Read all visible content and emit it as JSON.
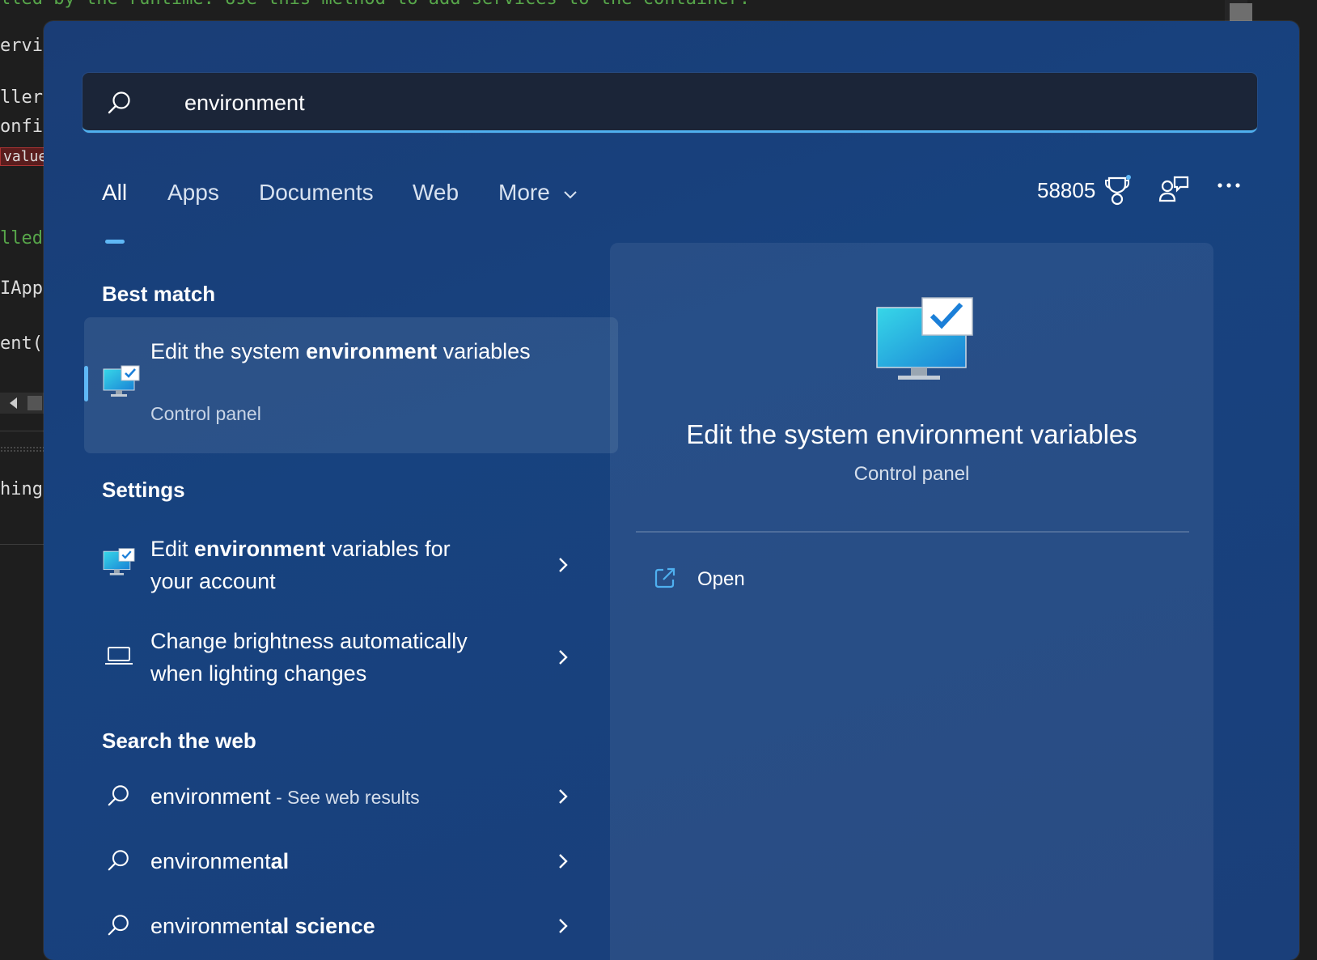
{
  "editor": {
    "lines": [
      {
        "text": "lled by the runtime. Use this method to add services to the container.",
        "style": "green"
      },
      {
        "text": "ervic",
        "style": "plain"
      },
      {
        "text": "llers",
        "style": "plain"
      },
      {
        "text": "onfig",
        "style": "plain"
      },
      {
        "text": "value",
        "style": "badge"
      },
      {
        "text": "lled",
        "style": "green"
      },
      {
        "text": "IApp",
        "style": "plain"
      },
      {
        "text": "ent(",
        "style": "plain"
      },
      {
        "text": "hings",
        "style": "plain"
      }
    ]
  },
  "search": {
    "value": "environment",
    "icon": "search-icon"
  },
  "tabs": [
    {
      "label": "All",
      "active": true
    },
    {
      "label": "Apps",
      "active": false
    },
    {
      "label": "Documents",
      "active": false
    },
    {
      "label": "Web",
      "active": false
    },
    {
      "label": "More",
      "active": false
    }
  ],
  "toolbar": {
    "points": "58805",
    "icons": [
      "rewards-trophy-icon",
      "people-chat-icon",
      "more-options-icon"
    ],
    "accent": "#5fb8f6"
  },
  "best_match": {
    "heading": "Best match",
    "title_pre": "Edit the system ",
    "title_bold": "environment",
    "title_post": " variables",
    "subtitle": "Control panel"
  },
  "settings": {
    "heading": "Settings",
    "items": [
      {
        "pre": "Edit ",
        "bold": "environment",
        "post": " variables for your account"
      },
      {
        "pre": "Change brightness automatically when lighting changes",
        "bold": "",
        "post": ""
      }
    ]
  },
  "web": {
    "heading": "Search the web",
    "items": [
      {
        "main": "environment",
        "bold": "",
        "suffix": " - See web results"
      },
      {
        "main": "environment",
        "bold": "al",
        "suffix": ""
      },
      {
        "main": "environment",
        "bold": "al science",
        "suffix": ""
      }
    ]
  },
  "preview": {
    "title": "Edit the system environment variables",
    "subtitle": "Control panel",
    "action": "Open"
  }
}
